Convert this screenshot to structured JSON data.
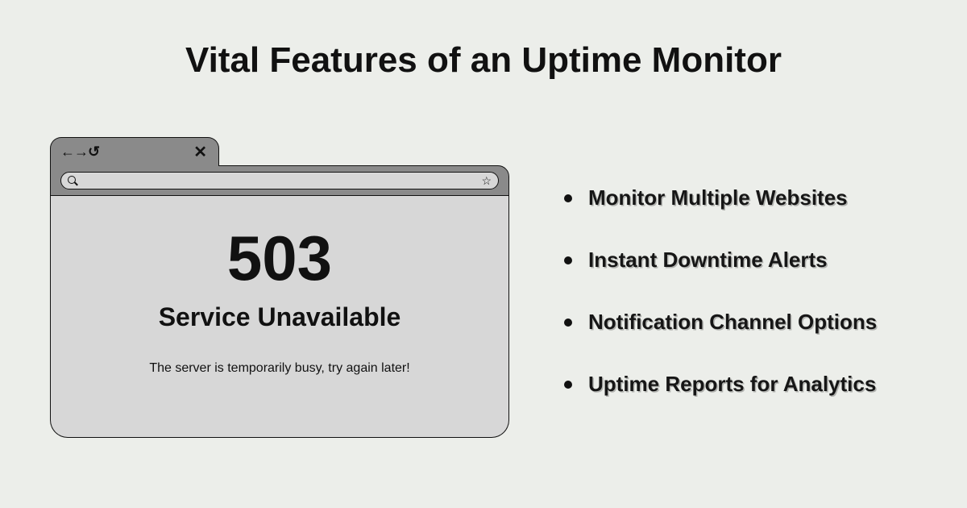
{
  "title": "Vital Features of an Uptime Monitor",
  "browser": {
    "nav_arrows": "←→↺",
    "close": "✕",
    "star": "☆",
    "error_code": "503",
    "error_status": "Service Unavailable",
    "error_message": "The server is temporarily busy, try again later!"
  },
  "features": [
    "Monitor Multiple Websites",
    "Instant Downtime Alerts",
    "Notification Channel Options",
    "Uptime Reports for Analytics"
  ]
}
